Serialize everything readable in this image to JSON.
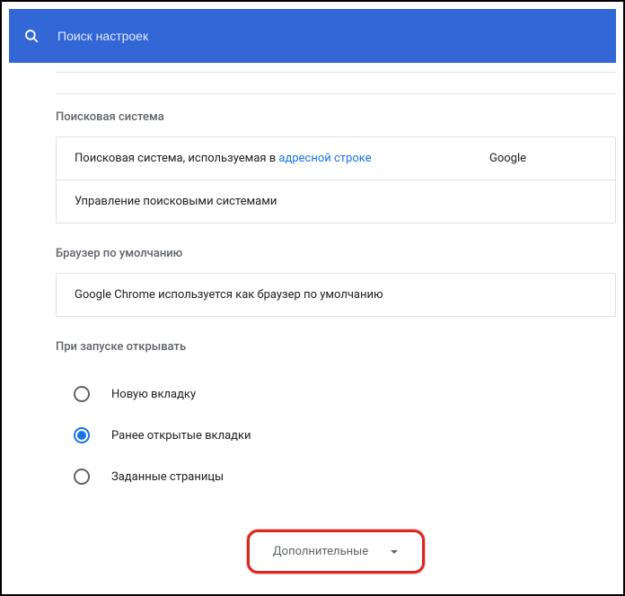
{
  "header": {
    "search_placeholder": "Поиск настроек"
  },
  "sections": {
    "search_engine": {
      "title": "Поисковая система",
      "row1_prefix": "Поисковая система, используемая в ",
      "row1_link": "адресной строке",
      "row1_value": "Google",
      "row2_label": "Управление поисковыми системами"
    },
    "default_browser": {
      "title": "Браузер по умолчанию",
      "status": "Google Chrome используется как браузер по умолчанию"
    },
    "on_startup": {
      "title": "При запуске открывать",
      "options": [
        {
          "label": "Новую вкладку",
          "selected": false
        },
        {
          "label": "Ранее открытые вкладки",
          "selected": true
        },
        {
          "label": "Заданные страницы",
          "selected": false
        }
      ]
    }
  },
  "advanced": {
    "label": "Дополнительные"
  }
}
